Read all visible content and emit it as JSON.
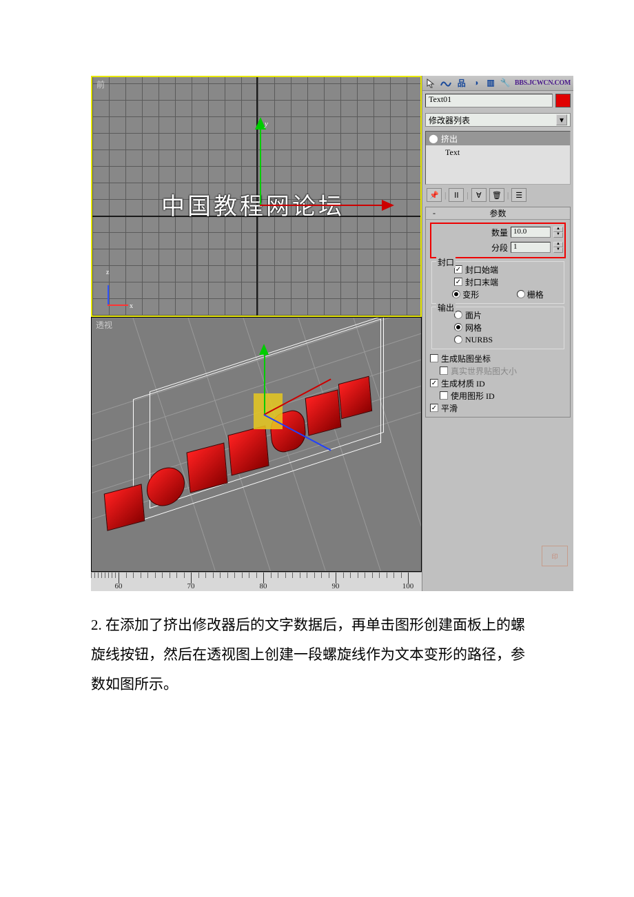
{
  "viewports": {
    "front_label": "前",
    "persp_label": "透视",
    "watermark": "中国教程网论坛",
    "gizmo_y": "y",
    "mini_z": "z",
    "mini_x": "x",
    "ruler_ticks": [
      "60",
      "70",
      "80",
      "90",
      "100"
    ]
  },
  "panel": {
    "bbs": "BBS.JCWCN.COM",
    "object_name": "Text01",
    "modifier_list_label": "修改器列表",
    "stack": {
      "modifier": "挤出",
      "base": "Text"
    },
    "rollout_title": "参数",
    "amount_label": "数量",
    "amount_value": "10.0",
    "segments_label": "分段",
    "segments_value": "1",
    "cap_group": "封口",
    "cap_start": "封口始端",
    "cap_end": "封口末端",
    "morph": "变形",
    "grid": "栅格",
    "output_group": "输出",
    "output_patch": "面片",
    "output_mesh": "网格",
    "output_nurbs": "NURBS",
    "gen_map": "生成贴图坐标",
    "real_world": "真实世界贴图大小",
    "gen_mat": "生成材质 ID",
    "use_shape": "使用图形 ID",
    "smooth": "平滑"
  },
  "caption": "2. 在添加了挤出修改器后的文字数据后，再单击图形创建面板上的螺旋线按钮，然后在透视图上创建一段螺旋线作为文本变形的路径，参数如图所示。"
}
